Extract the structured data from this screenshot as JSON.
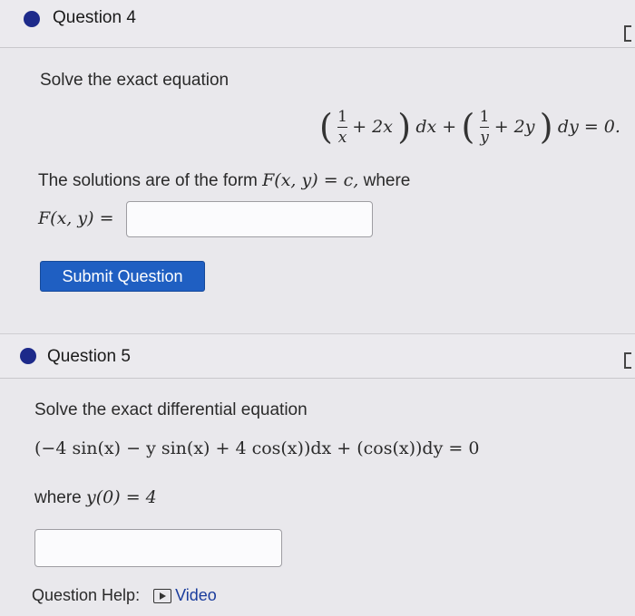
{
  "q4": {
    "title": "Question 4",
    "prompt": "Solve the exact equation",
    "eq": {
      "frac1_num": "1",
      "frac1_den": "x",
      "term1": "+ 2x",
      "dx": "dx +",
      "frac2_num": "1",
      "frac2_den": "y",
      "term2": "+ 2y",
      "dy": "dy = 0."
    },
    "form_text": "The solutions are of the form",
    "form_math": "F(x, y) = c,",
    "form_where": "where",
    "answer_label": "F(x, y) =",
    "answer_value": "",
    "submit_label": "Submit Question"
  },
  "q5": {
    "title": "Question 5",
    "prompt": "Solve the exact differential equation",
    "equation": "(−4 sin(x) − y sin(x) + 4 cos(x))dx + (cos(x))dy = 0",
    "where_label": "where",
    "initial_condition": "y(0) = 4",
    "answer_value": "",
    "help_label": "Question Help:",
    "video_label": "Video"
  },
  "colors": {
    "accent": "#1f5fc2",
    "dot": "#1d2a8a",
    "background": "#e9e8ec"
  },
  "icons": {
    "bullet": "filled-circle",
    "video": "play-video-icon"
  }
}
